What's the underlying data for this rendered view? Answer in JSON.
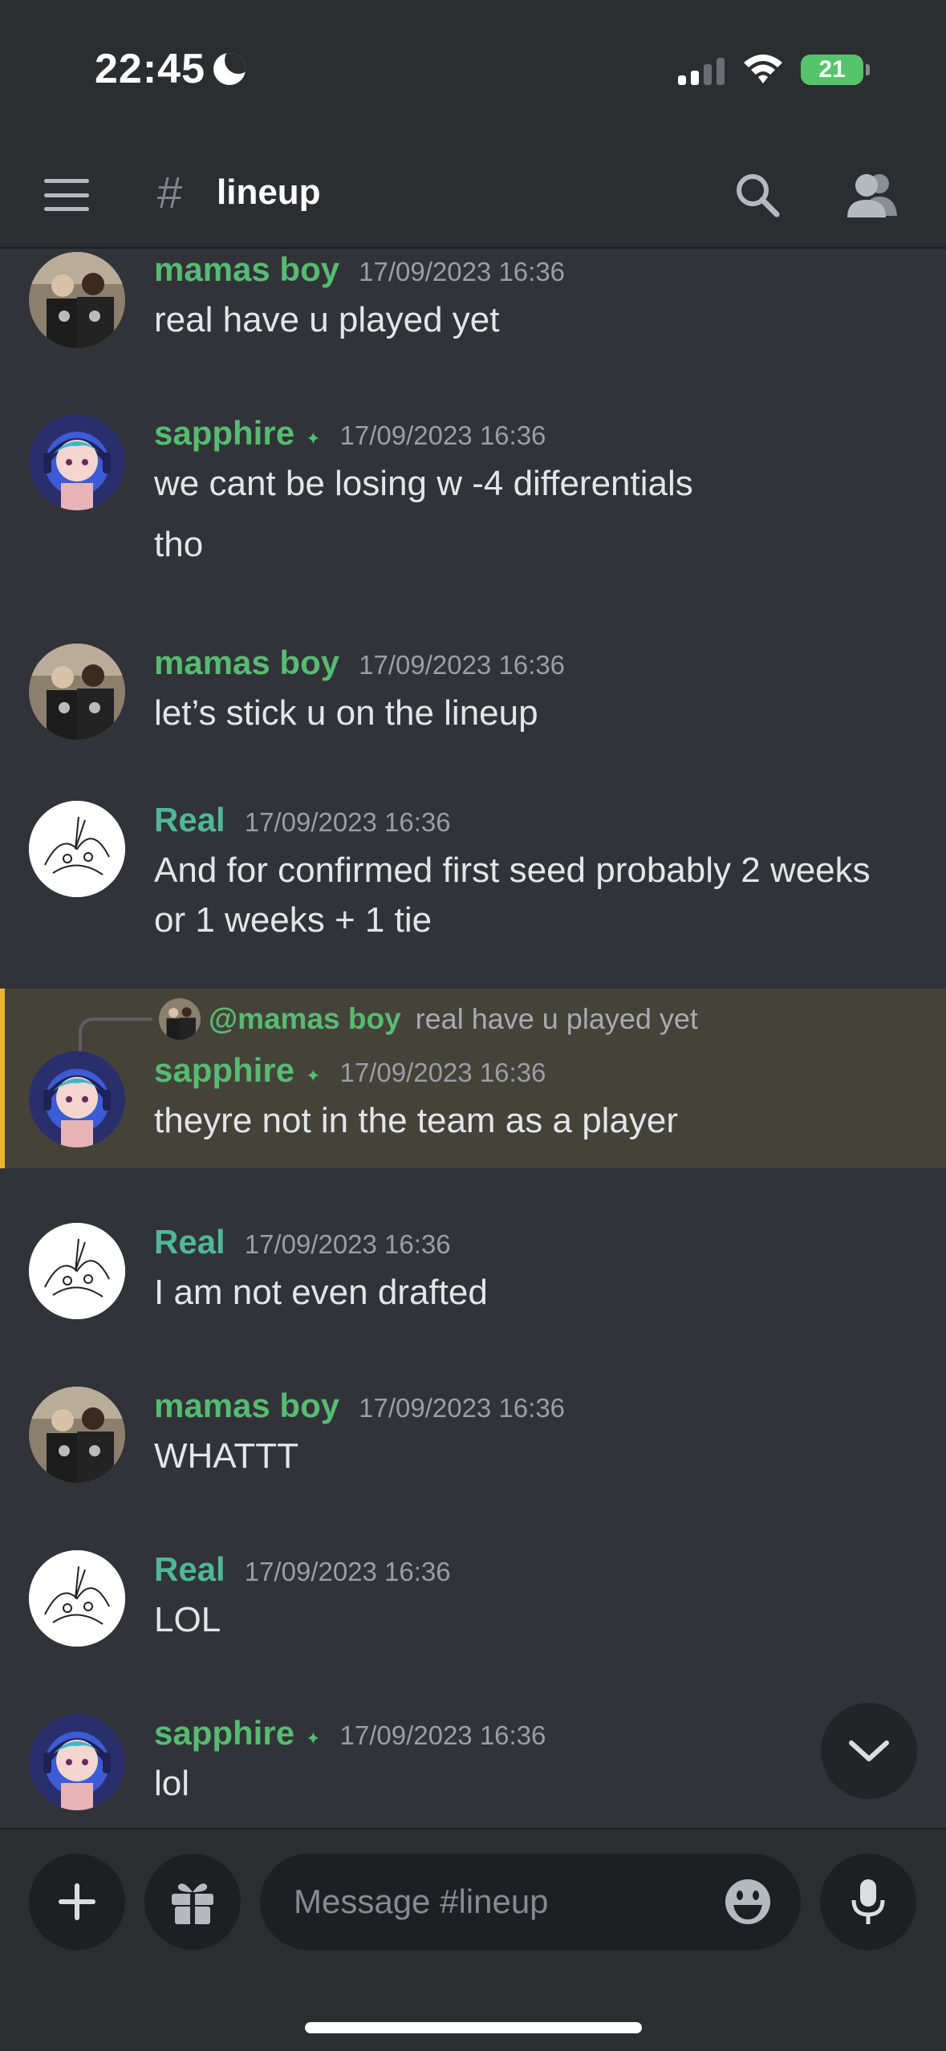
{
  "status": {
    "time": "22:45",
    "battery": "21"
  },
  "header": {
    "hash": "#",
    "channel": "lineup"
  },
  "messages": [
    {
      "user": "mamas boy",
      "time": "17/09/2023 16:36",
      "lines": [
        "real have u played yet"
      ]
    },
    {
      "user": "sapphire",
      "badge": "✦",
      "time": "17/09/2023 16:36",
      "lines": [
        "we cant be losing w -4 differentials",
        "tho"
      ]
    },
    {
      "user": "mamas boy",
      "time": "17/09/2023 16:36",
      "lines": [
        "let’s stick u on the lineup"
      ]
    },
    {
      "user": "Real",
      "time": "17/09/2023 16:36",
      "lines": [
        "And for confirmed first seed probably 2 weeks",
        "or 1 weeks + 1 tie"
      ]
    },
    {
      "reply_user": "@mamas boy",
      "reply_text": "real have u played yet",
      "user": "sapphire",
      "badge": "✦",
      "time": "17/09/2023 16:36",
      "lines": [
        "theyre not in the team as a player"
      ]
    },
    {
      "user": "Real",
      "time": "17/09/2023 16:36",
      "lines": [
        "I am not even drafted"
      ]
    },
    {
      "user": "mamas boy",
      "time": "17/09/2023 16:36",
      "lines": [
        "WHATTT"
      ]
    },
    {
      "user": "Real",
      "time": "17/09/2023 16:36",
      "lines": [
        "LOL"
      ]
    },
    {
      "user": "sapphire",
      "badge": "✦",
      "time": "17/09/2023 16:36",
      "lines": [
        "lol"
      ]
    }
  ],
  "composer": {
    "placeholder": "Message #lineup"
  },
  "icons": [
    "menu-icon",
    "search-icon",
    "members-icon",
    "plus-icon",
    "gift-icon",
    "emoji-icon",
    "mic-icon",
    "chevron-down-icon",
    "wifi-icon",
    "moon-icon"
  ],
  "colors": {
    "background": "#313338",
    "header": "#2b2d31",
    "username": "#57bb72",
    "highlight": "#45423a",
    "highlight_bar": "#f0b232"
  }
}
